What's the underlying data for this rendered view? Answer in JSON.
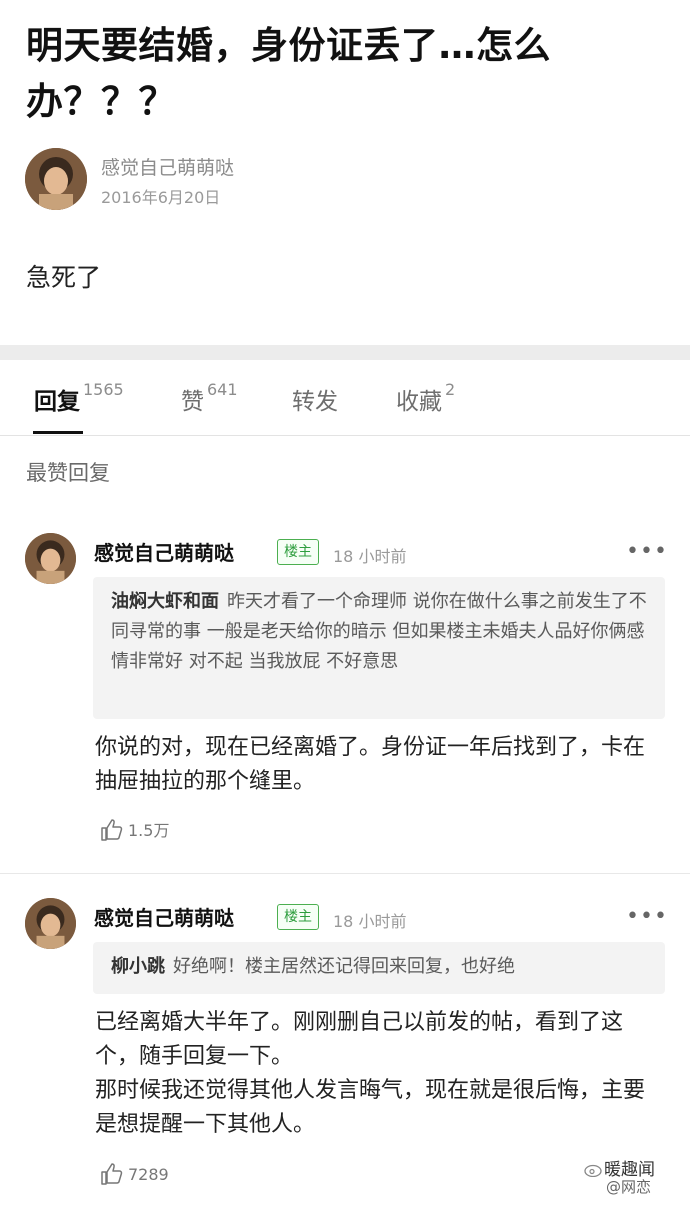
{
  "post": {
    "title": "明天要结婚，身份证丢了…怎么办？？？",
    "author": "感觉自己萌萌哒",
    "date": "2016年6月20日",
    "body": "急死了"
  },
  "tabs": [
    {
      "label": "回复",
      "count": "1565",
      "active": true
    },
    {
      "label": "赞",
      "count": "641",
      "active": false
    },
    {
      "label": "转发",
      "count": "",
      "active": false
    },
    {
      "label": "收藏",
      "count": "2",
      "active": false
    }
  ],
  "section_label": "最赞回复",
  "replies": [
    {
      "name": "感觉自己萌萌哒",
      "badge": "楼主",
      "time": "18 小时前",
      "more": "•••",
      "quote_author": "油焖大虾和面",
      "quote_text": "昨天才看了一个命理师 说你在做什么事之前发生了不同寻常的事 一般是老天给你的暗示 但如果楼主未婚夫人品好你俩感情非常好 对不起 当我放屁 不好意思",
      "text": "你说的对，现在已经离婚了。身份证一年后找到了，卡在抽屉抽拉的那个缝里。",
      "likes": "1.5万"
    },
    {
      "name": "感觉自己萌萌哒",
      "badge": "楼主",
      "time": "18 小时前",
      "more": "•••",
      "quote_author": "柳小跳",
      "quote_text": "好绝啊！楼主居然还记得回来回复，也好绝",
      "text": "已经离婚大半年了。刚刚删自己以前发的帖，看到了这个，随手回复一下。\n那时候我还觉得其他人发言晦气，现在就是很后悔，主要是想提醒一下其他人。",
      "likes": "7289"
    }
  ],
  "watermark": {
    "brand": "暖趣闻",
    "handle": "@网恋"
  },
  "icons": {
    "like": "thumbs-up-icon",
    "more": "more-dots-icon",
    "weibo": "weibo-logo"
  },
  "colors": {
    "op_badge": "#2e9e3e",
    "divider": "#ececec",
    "quote_bg": "#f3f3f3"
  }
}
